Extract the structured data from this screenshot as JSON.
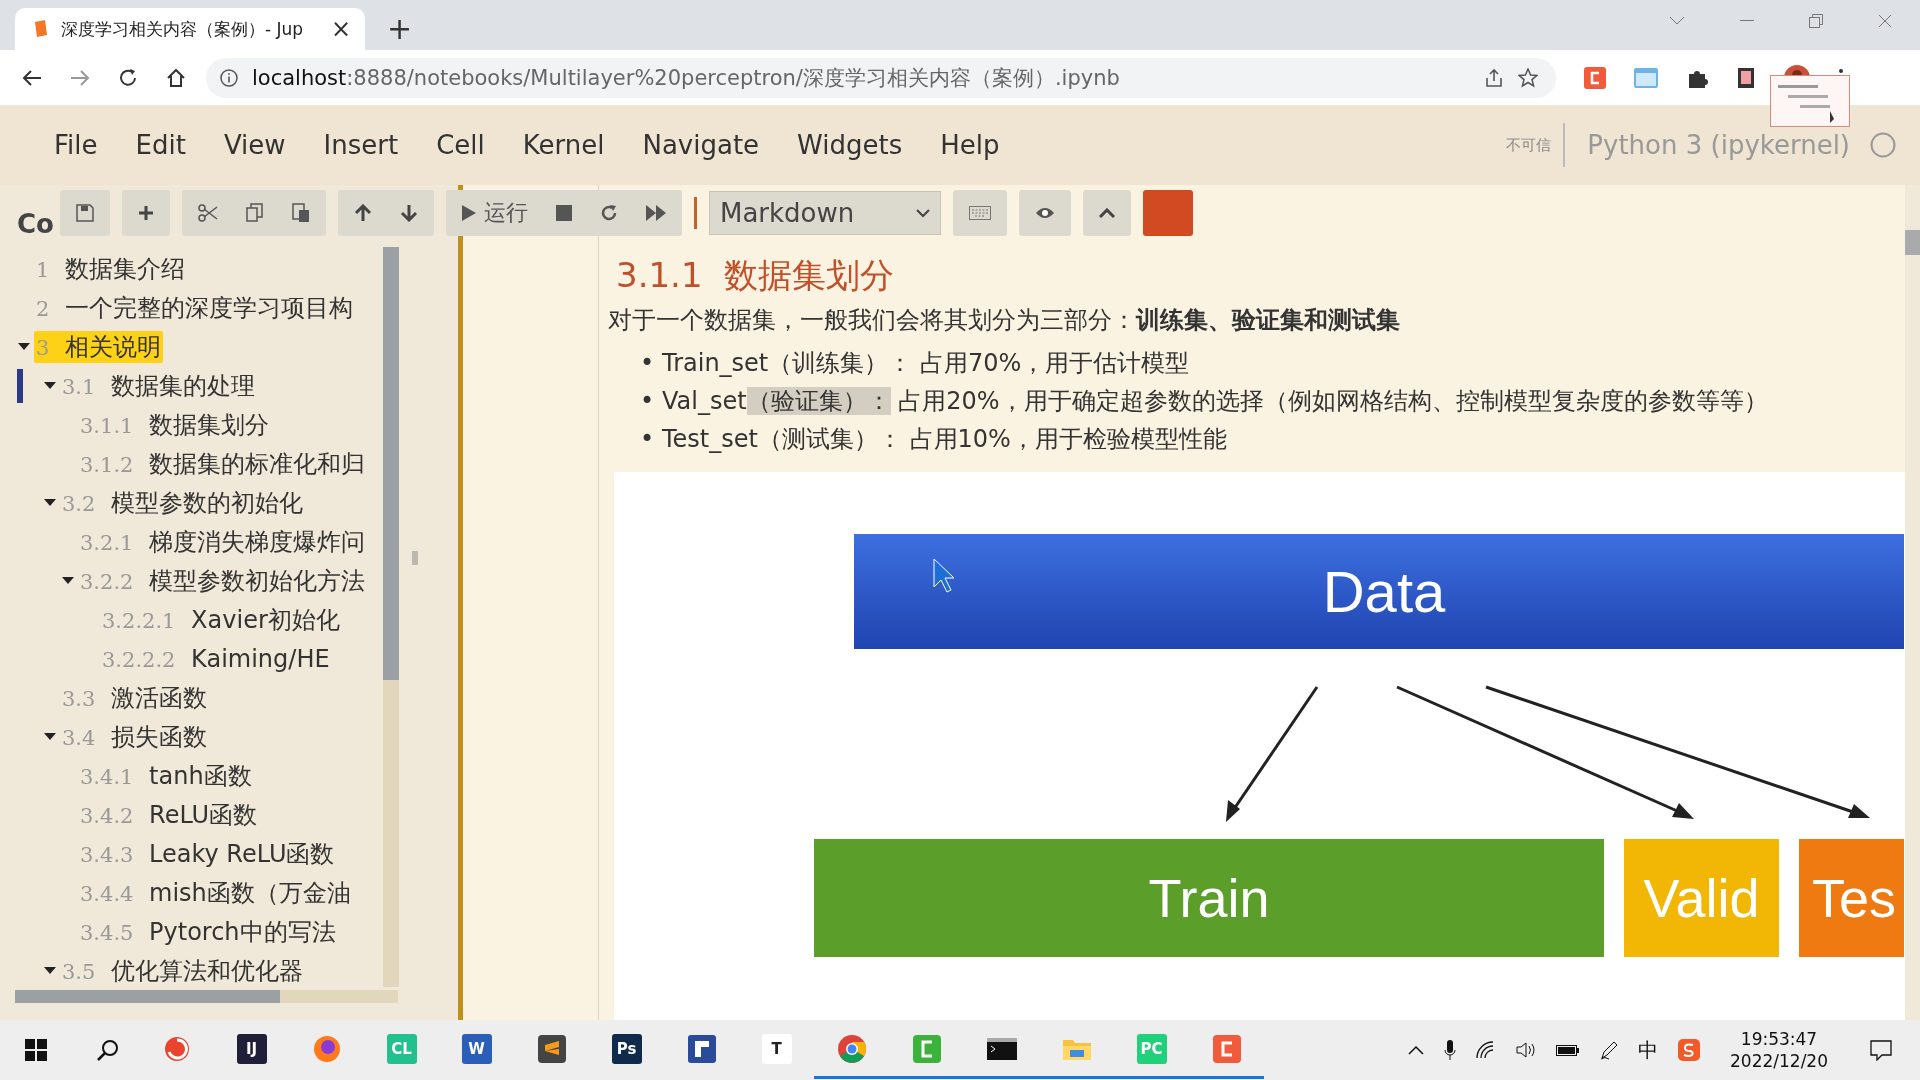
{
  "browser": {
    "tab": {
      "title": "深度学习相关内容（案例）- Jup",
      "close": "×"
    },
    "new_tab": "+",
    "url": {
      "host": "localhost",
      "path": ":8888/notebooks/Multilayer%20perceptron/深度学习相关内容（案例）.ipynb"
    }
  },
  "menubar": {
    "items": [
      "File",
      "Edit",
      "View",
      "Insert",
      "Cell",
      "Kernel",
      "Navigate",
      "Widgets",
      "Help"
    ],
    "trust": "不可信",
    "kernel": "Python 3 (ipykernel)"
  },
  "toolbar": {
    "run_label": "运行",
    "cell_type": "Markdown"
  },
  "toc": {
    "title": "Co",
    "items": [
      {
        "number": "1",
        "title": "数据集介绍",
        "selected": false,
        "current": false
      },
      {
        "number": "2",
        "title": "一个完整的深度学习项目构",
        "selected": false,
        "current": false
      },
      {
        "number": "3",
        "title": "相关说明",
        "selected": true,
        "current": false,
        "expanded": true,
        "children": [
          {
            "number": "3.1",
            "title": "数据集的处理",
            "selected": false,
            "current": true,
            "expanded": true,
            "children": [
              {
                "number": "3.1.1",
                "title": "数据集划分",
                "selected": false,
                "current": false
              },
              {
                "number": "3.1.2",
                "title": "数据集的标准化和归",
                "selected": false,
                "current": false
              }
            ]
          },
          {
            "number": "3.2",
            "title": "模型参数的初始化",
            "selected": false,
            "current": false,
            "expanded": true,
            "children": [
              {
                "number": "3.2.1",
                "title": "梯度消失梯度爆炸问",
                "selected": false,
                "current": false
              },
              {
                "number": "3.2.2",
                "title": "模型参数初始化方法",
                "selected": false,
                "current": false,
                "expanded": true,
                "children": [
                  {
                    "number": "3.2.2.1",
                    "title": "Xavier初始化",
                    "selected": false,
                    "current": false
                  },
                  {
                    "number": "3.2.2.2",
                    "title": "Kaiming/HE",
                    "selected": false,
                    "current": false
                  }
                ]
              }
            ]
          },
          {
            "number": "3.3",
            "title": "激活函数",
            "selected": false,
            "current": false
          },
          {
            "number": "3.4",
            "title": "损失函数",
            "selected": false,
            "current": false,
            "expanded": true,
            "children": [
              {
                "number": "3.4.1",
                "title": "tanh函数",
                "selected": false,
                "current": false
              },
              {
                "number": "3.4.2",
                "title": "ReLU函数",
                "selected": false,
                "current": false
              },
              {
                "number": "3.4.3",
                "title": "Leaky ReLU函数",
                "selected": false,
                "current": false
              },
              {
                "number": "3.4.4",
                "title": "mish函数（万金油",
                "selected": false,
                "current": false
              },
              {
                "number": "3.4.5",
                "title": "Pytorch中的写法",
                "selected": false,
                "current": false
              }
            ]
          },
          {
            "number": "3.5",
            "title": "优化算法和优化器",
            "selected": false,
            "current": false,
            "expanded": true
          }
        ]
      }
    ]
  },
  "cell": {
    "heading_number": "3.1.1",
    "heading": "数据集划分",
    "intro": "对于一个数据集，一般我们会将其划分为三部分：**训练集、验证集和测试集**",
    "bullets": [
      {
        "marker": "•",
        "parts": [
          {
            "text": "Train_set（训练集）： 占用70%，用于估计模型",
            "selected": false
          }
        ]
      },
      {
        "marker": "•",
        "parts": [
          {
            "text": "Val_set",
            "selected": false
          },
          {
            "text": "（验证集）：",
            "selected": true
          },
          {
            "text": " 占用20%，用于确定超参数的选择（例如网格结构、控制模型复杂度的参数等等）",
            "selected": false
          }
        ]
      },
      {
        "marker": "•",
        "parts": [
          {
            "text": "Test_set（测试集）： 占用10%，用于检验模型性能",
            "selected": false
          }
        ]
      }
    ],
    "diagram": {
      "top": "Data",
      "boxes": [
        {
          "label": "Train",
          "color": "#5b9e2a"
        },
        {
          "label": "Valid",
          "color": "#f2b705"
        },
        {
          "label": "Tes",
          "color": "#f07a12"
        }
      ]
    }
  },
  "taskbar": {
    "apps": [
      {
        "kind": "swirl",
        "running": false
      },
      {
        "kind": "tile",
        "glyph": "IJ",
        "color": "#1f1f3a",
        "running": false
      },
      {
        "kind": "firefox",
        "running": false
      },
      {
        "kind": "tile",
        "glyph": "CL",
        "color": "#21c08c",
        "running": false
      },
      {
        "kind": "tile",
        "glyph": "W",
        "color": "#2b5eb8",
        "running": false
      },
      {
        "kind": "sublime",
        "running": false
      },
      {
        "kind": "tile",
        "glyph": "Ps",
        "color": "#0f2a4a",
        "running": false
      },
      {
        "kind": "flag",
        "running": false
      },
      {
        "kind": "tile",
        "glyph": "T",
        "color": "#ffffff",
        "running": false
      },
      {
        "kind": "chrome",
        "running": true
      },
      {
        "kind": "camtasia",
        "running": true
      },
      {
        "kind": "terminal",
        "running": true
      },
      {
        "kind": "folder",
        "running": true
      },
      {
        "kind": "tile",
        "glyph": "PC",
        "color": "#21d07a",
        "running": true
      },
      {
        "kind": "redc",
        "running": true
      }
    ],
    "ime": "中",
    "time": "19:53:47",
    "date": "2022/12/20"
  }
}
